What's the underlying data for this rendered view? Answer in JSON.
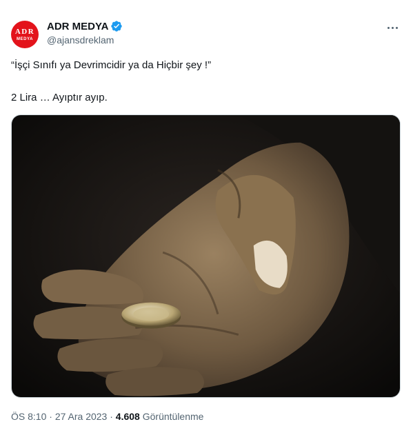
{
  "account": {
    "name": "ADR MEDYA",
    "handle": "@ajansdreklam",
    "avatar_top": "ADR",
    "avatar_bottom": "MEDYA",
    "avatar_color": "#e3131b",
    "verified_color": "#1d9bf0"
  },
  "tweet": {
    "line1": "“İşçi Sınıfı ya Devrimcidir ya da Hiçbir şey !”",
    "line2": "2 Lira … Ayıptır ayıp."
  },
  "meta": {
    "time": "ÖS 8:10",
    "separator": "·",
    "date": "27 Ara 2023",
    "views": "4.608",
    "views_label": "Görüntülenme"
  },
  "icons": {
    "more": "more-horizontal-icon",
    "verified": "verified-badge-icon"
  }
}
